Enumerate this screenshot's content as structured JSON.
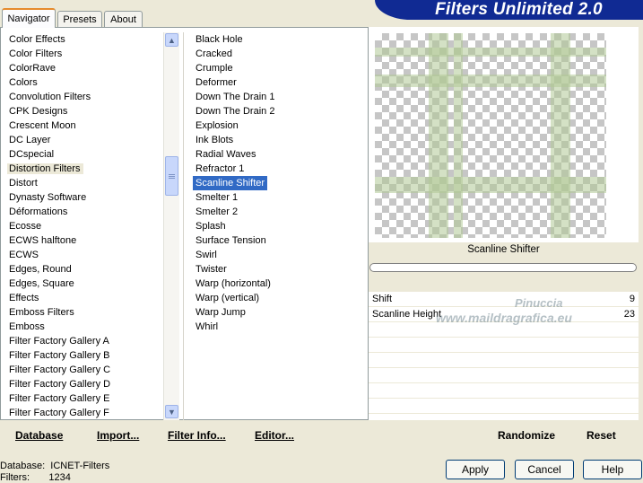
{
  "tabs": [
    {
      "label": "Navigator",
      "active": true
    },
    {
      "label": "Presets",
      "active": false
    },
    {
      "label": "About",
      "active": false
    }
  ],
  "app_title": "Filters Unlimited 2.0",
  "categories": [
    "Color Effects",
    "Color Filters",
    "ColorRave",
    "Colors",
    "Convolution Filters",
    "CPK Designs",
    "Crescent Moon",
    "DC Layer",
    "DCspecial",
    "Distortion Filters",
    "Distort",
    "Dynasty Software",
    "Déformations",
    "Ecosse",
    "ECWS halftone",
    "ECWS",
    "Edges, Round",
    "Edges, Square",
    "Effects",
    "Emboss Filters",
    "Emboss",
    "Filter Factory Gallery A",
    "Filter Factory Gallery B",
    "Filter Factory Gallery C",
    "Filter Factory Gallery D",
    "Filter Factory Gallery E",
    "Filter Factory Gallery F"
  ],
  "selected_category": "Distortion Filters",
  "filters": [
    "Black Hole",
    "Cracked",
    "Crumple",
    "Deformer",
    "Down The Drain 1",
    "Down The Drain 2",
    "Explosion",
    "Ink Blots",
    "Radial Waves",
    "Refractor 1",
    "Scanline Shifter",
    "Smelter 1",
    "Smelter 2",
    "Splash",
    "Surface Tension",
    "Swirl",
    "Twister",
    "Warp (horizontal)",
    "Warp (vertical)",
    "Warp Jump",
    "Whirl"
  ],
  "selected_filter": "Scanline Shifter",
  "preview": {
    "filter_name": "Scanline Shifter"
  },
  "params": [
    {
      "label": "Shift",
      "value": "9"
    },
    {
      "label": "Scanline Height",
      "value": "23"
    }
  ],
  "watermark": {
    "line1": "Pinuccia",
    "line2": "www.maildragrafica.eu"
  },
  "toolbar": {
    "database": "Database",
    "import": "Import...",
    "filter_info": "Filter Info...",
    "editor": "Editor...",
    "randomize": "Randomize",
    "reset": "Reset"
  },
  "status": {
    "database_label": "Database:",
    "database_value": "ICNET-Filters",
    "filters_label": "Filters:",
    "filters_value": "1234"
  },
  "buttons": {
    "apply": "Apply",
    "cancel": "Cancel",
    "help": "Help"
  },
  "colors": {
    "banner": "#102A93",
    "selection": "#316AC5",
    "window_bg": "#ECE9D8"
  }
}
